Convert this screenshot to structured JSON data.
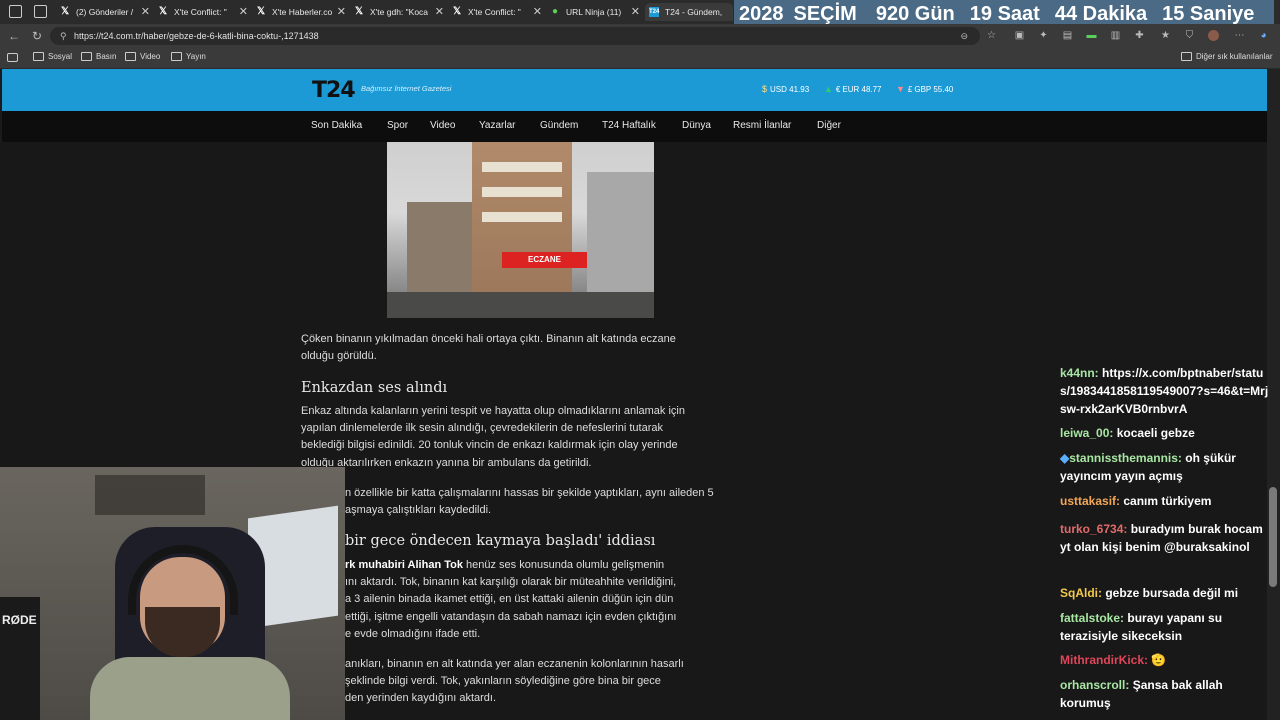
{
  "browser": {
    "tabs": [
      {
        "label": "(2) Gönderiler /",
        "icon": "x-icon"
      },
      {
        "label": "X'te Conflict: \"",
        "icon": "x-icon"
      },
      {
        "label": "X'te Haberler.co",
        "icon": "x-icon"
      },
      {
        "label": "X'te gdh: \"Koca",
        "icon": "x-icon"
      },
      {
        "label": "X'te Conflict: \"",
        "icon": "x-icon"
      },
      {
        "label": "URL Ninja (11)",
        "icon": "ninja-icon"
      },
      {
        "label": "T24 - Gündem,",
        "icon": "t24-icon"
      }
    ],
    "url": "https://t24.com.tr/haber/gebze-de-6-katli-bina-coktu-,1271438",
    "bookmarks": [
      "Sosyal",
      "Basın",
      "Video",
      "Yayın"
    ],
    "other_bookmarks": "Diğer sık kullanılanlar"
  },
  "countdown": {
    "year": "2028",
    "label": "SEÇİM",
    "days": "920 Gün",
    "hours": "19 Saat",
    "minutes": "44 Dakika",
    "seconds": "15 Saniye"
  },
  "site": {
    "logo": "T24",
    "tagline": "Bağımsız İnternet Gazetesi",
    "fx": {
      "usd": "USD 41.93",
      "eur": "EUR 48.77",
      "gbp": "GBP 55.40"
    },
    "nav": [
      "Son Dakika",
      "Spor",
      "Video",
      "Yazarlar",
      "Gündem",
      "T24 Haftalık",
      "Dünya",
      "Resmi İlanlar",
      "Diğer"
    ]
  },
  "article": {
    "caption_lines": [
      "Çöken binanın yıkılmadan önceki hali ortaya çıktı. Binanın alt katında eczane",
      "olduğu görüldü."
    ],
    "heading1": "Enkazdan ses alındı",
    "para1": [
      "Enkaz altında kalanların yerini tespit ve hayatta olup olmadıklarını anlamak için",
      "yapılan dinlemelerde ilk sesin alındığı, çevredekilerin de nefeslerini tutarak",
      "beklediği bilgisi edinildi. 20 tonluk vincin de enkazı kaldırmak için olay yerinde",
      "olduğu aktarılırken enkazın yanına bir ambulans da getirildi."
    ],
    "para2": [
      "n özellikle bir katta çalışmalarını hassas bir şekilde yaptıkları, aynı aileden 5",
      "aşmaya çalıştıkları kaydedildi."
    ],
    "heading2": "bir gece öndecen kaymaya başladı' iddiası",
    "para3_bold": "rk muhabiri Alihan Tok",
    "para3_rest": " henüz ses konusunda olumlu gelişmenin",
    "para3": [
      "ını aktardı. Tok, binanın kat karşılığı olarak bir müteahhite verildiğini,",
      "a 3 ailenin binada ikamet ettiği, en üst kattaki ailenin düğün için dün",
      "ettiği, işitme engelli vatandaşın da sabah namazı için evden çıktığını",
      "e evde olmadığını ifade etti."
    ],
    "para4": [
      "anıkları, binanın en alt katında yer alan eczanenin kolonlarının hasarlı",
      "şeklinde bilgi verdi. Tok, yakınların söylediğine göre bina bir gece",
      "den yerinden kaydığını aktardı."
    ],
    "photo_sign": "ECZANE"
  },
  "chat": [
    {
      "user": "k44nn:",
      "text": "https://x.com/bptnaber/status/1983441858119549007?s=46&t=Mrjsw-rxk2arKVB0rnbvrA",
      "color": "#ffffff",
      "partial": true
    },
    {
      "user": "leiwa_00:",
      "text": "kocaeli gebze",
      "color": "#a8e6a3"
    },
    {
      "user": "stannissthemannis:",
      "text": "oh şükür yayıncım yayın açmış",
      "color": "#a8e6a3",
      "badge": "🧊"
    },
    {
      "user": "usttakasif:",
      "text": "canım türkiyem",
      "color": "#f2a65a"
    },
    {
      "user": "turko_6734:",
      "text": "buradyım burak hocam yt olan kişi benim @buraksakinol",
      "color": "#e06a6a"
    },
    {
      "user": "SqAldi:",
      "text": "gebze bursada değil mi",
      "color": "#f2c94c"
    },
    {
      "user": "fattalstoke:",
      "text": "burayı yapanı su terazisiyle sikeceksin",
      "color": "#a8e6a3"
    },
    {
      "user": "MithrandirKick:",
      "text": "🫡",
      "color": "#e0455a"
    },
    {
      "user": "orhanscroll:",
      "text": "Şansa bak allah korumuş",
      "color": "#a8e6a3"
    }
  ],
  "webcam": {
    "label": "RØDE"
  }
}
